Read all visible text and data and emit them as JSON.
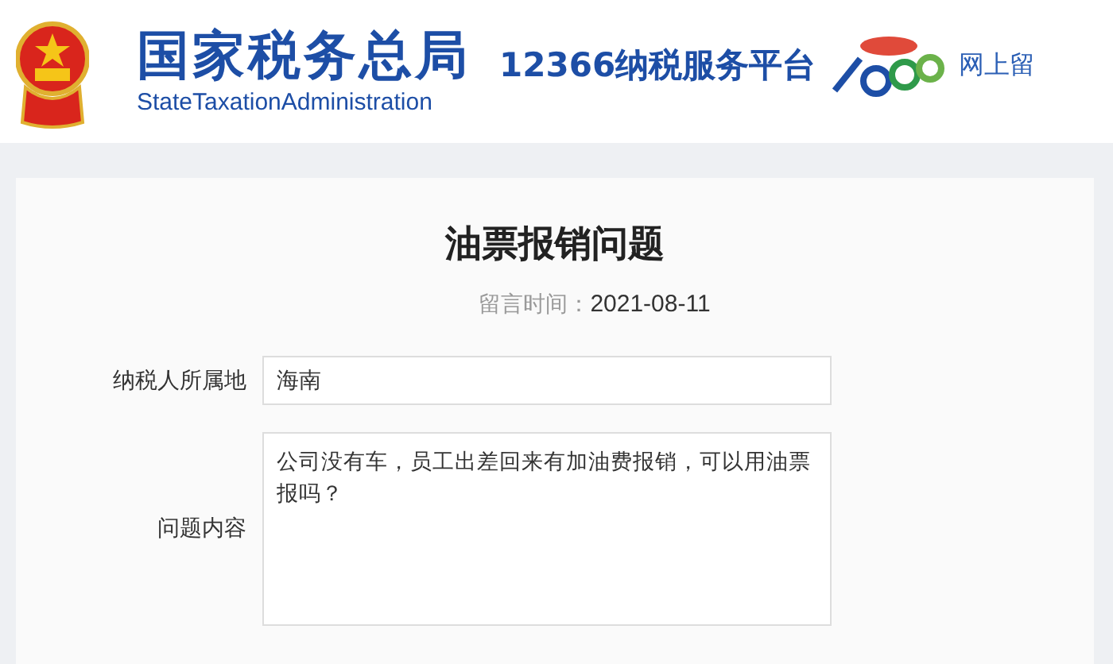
{
  "header": {
    "agency_name": "国家税务总局",
    "agency_name_en": "StateTaxationAdministration",
    "platform_name": "12366纳税服务平台",
    "nav_link": "网上留"
  },
  "message": {
    "title": "油票报销问题",
    "time_label": "留言时间：",
    "time_value": "2021-08-11",
    "fields": [
      {
        "kind": "input",
        "label": "纳税人所属地",
        "value": "海南"
      },
      {
        "kind": "textarea",
        "label": "问题内容",
        "value": "公司没有车，员工出差回来有加油费报销，可以用油票报吗？"
      }
    ]
  }
}
